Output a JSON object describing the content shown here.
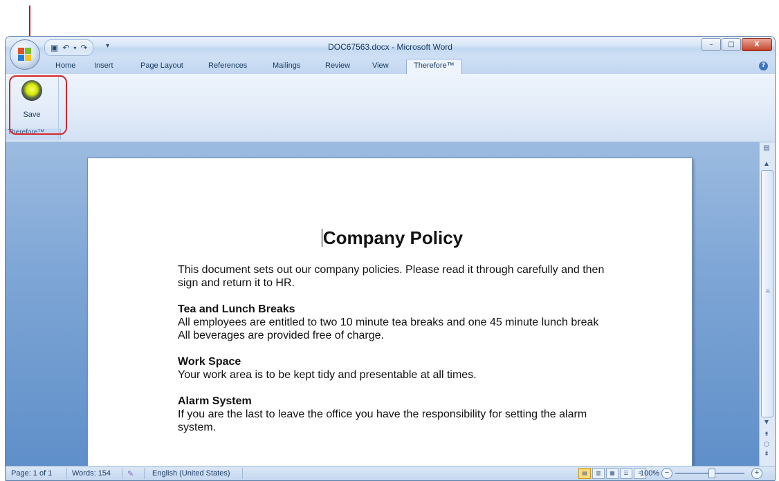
{
  "window": {
    "title": "DOC67563.docx - Microsoft Word",
    "controls": {
      "minimize": "–",
      "maximize": "□",
      "close": "X"
    }
  },
  "quick_access": {
    "save_icon": "floppy-icon",
    "undo_icon": "undo-icon",
    "redo_icon": "redo-icon",
    "dropdown": "▾"
  },
  "tabs": [
    {
      "label": "Home"
    },
    {
      "label": "Insert"
    },
    {
      "label": "Page Layout"
    },
    {
      "label": "References"
    },
    {
      "label": "Mailings"
    },
    {
      "label": "Review"
    },
    {
      "label": "View"
    },
    {
      "label": "Therefore™"
    }
  ],
  "active_tab": "Therefore™",
  "ribbon": {
    "save_label": "Save",
    "group_label": "Therefore™"
  },
  "document": {
    "title": "Company Policy",
    "intro": "This document sets out our company policies. Please read it through carefully and then sign and return it to HR.",
    "sections": [
      {
        "heading": "Tea and Lunch Breaks",
        "lines": [
          "All employees are entitled to two 10 minute tea breaks and one 45 minute lunch break",
          "All beverages are provided free of charge."
        ]
      },
      {
        "heading": "Work Space",
        "lines": [
          "Your work area is to be kept tidy and presentable at all times."
        ]
      },
      {
        "heading": "Alarm System",
        "lines": [
          "If you are the last to leave the office you have the responsibility for setting the alarm system."
        ]
      }
    ]
  },
  "status": {
    "page": "Page: 1 of 1",
    "words": "Words: 154",
    "language": "English (United States)",
    "zoom": "100%"
  },
  "colors": {
    "highlight": "#d8252e",
    "ribbon_bg": "#e1ebf8",
    "workspace": "#7ea6d6"
  }
}
